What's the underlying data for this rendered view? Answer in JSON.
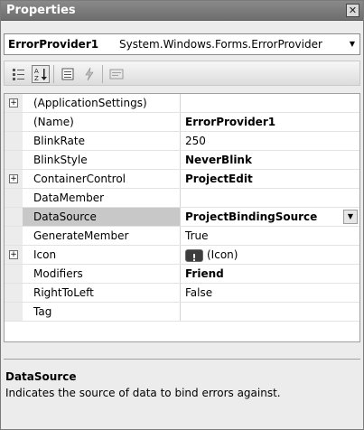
{
  "window": {
    "title": "Properties"
  },
  "object_selector": {
    "name": "ErrorProvider1",
    "type": "System.Windows.Forms.ErrorProvider"
  },
  "toolbar": {
    "buttons": [
      {
        "id": "categorized",
        "icon": "categorized-icon",
        "active": false
      },
      {
        "id": "alphabetical",
        "icon": "alphabetical-sort-icon",
        "active": true
      },
      {
        "id": "properties",
        "icon": "properties-icon",
        "active": false
      },
      {
        "id": "events",
        "icon": "events-icon",
        "active": false
      },
      {
        "id": "property-pages",
        "icon": "property-pages-icon",
        "active": false
      }
    ]
  },
  "properties": [
    {
      "name": "(ApplicationSettings)",
      "value": "",
      "bold": false,
      "expandable": true
    },
    {
      "name": "(Name)",
      "value": "ErrorProvider1",
      "bold": true,
      "expandable": false
    },
    {
      "name": "BlinkRate",
      "value": "250",
      "bold": false,
      "expandable": false
    },
    {
      "name": "BlinkStyle",
      "value": "NeverBlink",
      "bold": true,
      "expandable": false
    },
    {
      "name": "ContainerControl",
      "value": "ProjectEdit",
      "bold": true,
      "expandable": true
    },
    {
      "name": "DataMember",
      "value": "",
      "bold": false,
      "expandable": false
    },
    {
      "name": "DataSource",
      "value": "ProjectBindingSource",
      "bold": true,
      "expandable": false,
      "selected": true
    },
    {
      "name": "GenerateMember",
      "value": "True",
      "bold": false,
      "expandable": false
    },
    {
      "name": "Icon",
      "value": "(Icon)",
      "bold": false,
      "expandable": true,
      "has_icon": true
    },
    {
      "name": "Modifiers",
      "value": "Friend",
      "bold": true,
      "expandable": false
    },
    {
      "name": "RightToLeft",
      "value": "False",
      "bold": false,
      "expandable": false
    },
    {
      "name": "Tag",
      "value": "",
      "bold": false,
      "expandable": false
    }
  ],
  "description": {
    "title": "DataSource",
    "text": "Indicates the source of data to bind errors against."
  },
  "colors": {
    "titlebar": "#7a7a7a",
    "selected_row": "#c8c8c8"
  }
}
